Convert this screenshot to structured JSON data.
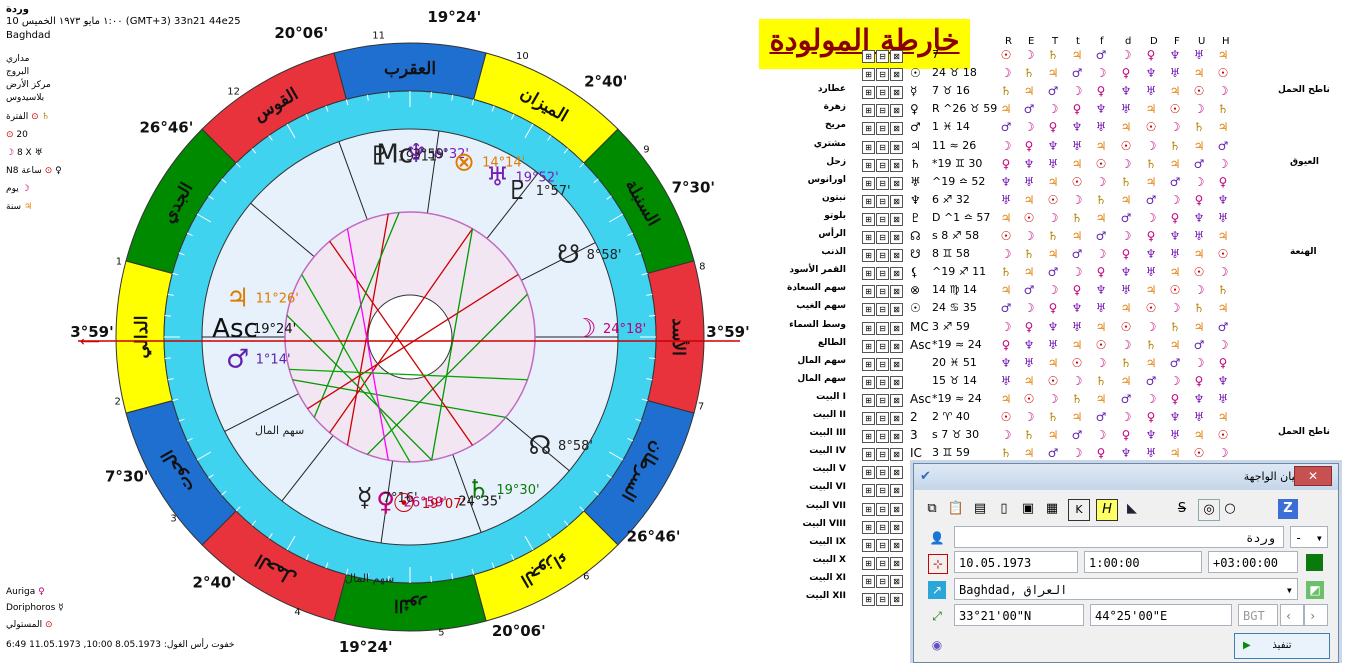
{
  "header": {
    "name": "وردة",
    "date_line": "10 ١:٠٠ مايو ١٩٧٣ الخميس (GMT+3) 33n21 44e25",
    "city": "Baghdad",
    "lines": [
      "مداري",
      "البروج",
      "مركز الأرض",
      "بلاسيدوس"
    ],
    "period_label": "الفترة",
    "period_value": "20",
    "lunar_line": "8 X",
    "hour_line": "N8 ساعة",
    "day_label": "يوم",
    "year_label": "سنة"
  },
  "title": "خارطة المولودة",
  "wheel": {
    "center_labels": [
      "سهم المال",
      "سهم المال"
    ],
    "zodiac_names": [
      "العقرب",
      "الميزان",
      "السنبلة",
      "الأسد",
      "السرطان",
      "الجوزاء",
      "الثور",
      "الحمل",
      "الحوت",
      "الدالي",
      "الجدي",
      "القوس"
    ],
    "outer_degrees": [
      "3°59'",
      "7°30'",
      "2°40'",
      "19°24'",
      "20°06'",
      "26°46'",
      "3°59'",
      "7°30'",
      "2°40'",
      "19°24'",
      "20°06'",
      "26°46'"
    ],
    "house_numbers": [
      "1",
      "2",
      "3",
      "4",
      "5",
      "6",
      "7",
      "8",
      "9",
      "10",
      "11",
      "12"
    ],
    "planet_positions": [
      {
        "glyph": "♀",
        "deg": "26°59'"
      },
      {
        "glyph": "☿",
        "deg": "7°16'"
      },
      {
        "glyph": "☉",
        "deg": "19°07'"
      },
      {
        "glyph": "♄",
        "deg": "19°30'"
      },
      {
        "glyph": "☊",
        "deg": "8°58'"
      },
      {
        "glyph": "☽",
        "deg": "24°18'"
      },
      {
        "glyph": "♃",
        "deg": "11°26'"
      },
      {
        "glyph": "♂",
        "deg": "1°14'"
      },
      {
        "glyph": "☋",
        "deg": "8°58'"
      },
      {
        "glyph": "♇",
        "deg": "19°11'"
      },
      {
        "glyph": "♆",
        "deg": "6°32'"
      },
      {
        "glyph": "♅",
        "deg": "19°52'"
      },
      {
        "glyph": "♇",
        "deg": "1°57'"
      },
      {
        "glyph": "⊗",
        "deg": "14°14'"
      },
      {
        "glyph": "Mc",
        "deg": "3°59'"
      },
      {
        "glyph": "Asc",
        "deg": "19°24'"
      },
      {
        "glyph": "",
        "deg": "24°35'"
      }
    ],
    "axis_labels": [
      "Mc",
      "Asc",
      "IC",
      "MC"
    ]
  },
  "bottom_left": {
    "star1": "Auriga",
    "star2": "Doriphoros",
    "ruler": "المستولي",
    "footer": "خفوت رأس الغول: 8.05.1973 10:00,   11.05.1973  6:49"
  },
  "table": {
    "columns": [
      "R",
      "E",
      "T",
      "t",
      "f",
      "d",
      "D",
      "F",
      "U",
      "H"
    ],
    "rows": [
      {
        "label": "",
        "planet": "",
        "pos": "7"
      },
      {
        "label": "",
        "planet": "☉",
        "pos": "24 ♉ 18"
      },
      {
        "label": "عطارد",
        "planet": "☿",
        "pos": "7 ♉ 16"
      },
      {
        "label": "زهرة",
        "planet": "♀",
        "pos": "R ^26 ♉ 59"
      },
      {
        "label": "مريخ",
        "planet": "♂",
        "pos": "1 ♓ 14"
      },
      {
        "label": "مشتري",
        "planet": "♃",
        "pos": "11 ≈ 26"
      },
      {
        "label": "زحل",
        "planet": "♄",
        "pos": "*19 ♊ 30"
      },
      {
        "label": "اورانوس",
        "planet": "♅",
        "pos": "^19 ≏ 52"
      },
      {
        "label": "نبتون",
        "planet": "♆",
        "pos": "6 ♐ 32"
      },
      {
        "label": "بلوتو",
        "planet": "♇",
        "pos": "D ^1 ≏ 57"
      },
      {
        "label": "الرأس",
        "planet": "☊",
        "pos": "s 8 ♐ 58"
      },
      {
        "label": "الذنب",
        "planet": "☋",
        "pos": "8 ♊ 58"
      },
      {
        "label": "القمر الأسود",
        "planet": "⚸",
        "pos": "^19 ♐ 11"
      },
      {
        "label": "سهم السعادة",
        "planet": "⊗",
        "pos": "14 ♍ 14"
      },
      {
        "label": "سهم الغيب",
        "planet": "☉",
        "pos": "24 ♋ 35"
      },
      {
        "label": "وسط السماء",
        "planet": "MC",
        "pos": "3 ♐ 59"
      },
      {
        "label": "الطالع",
        "planet": "Asc",
        "pos": "*19 ≈ 24"
      },
      {
        "label": "سهم المال",
        "planet": "",
        "pos": "20 ♓ 51"
      },
      {
        "label": "سهم المال",
        "planet": "",
        "pos": "15 ♉ 14"
      },
      {
        "label": "البيت I",
        "planet": "Asc",
        "pos": "*19 ≈ 24"
      },
      {
        "label": "البيت II",
        "planet": "2",
        "pos": "2 ♈ 40"
      },
      {
        "label": "البيت III",
        "planet": "3",
        "pos": "s 7 ♉ 30"
      },
      {
        "label": "البيت IV",
        "planet": "IC",
        "pos": "3 ♊ 59"
      },
      {
        "label": "البيت V",
        "planet": "",
        "pos": ""
      },
      {
        "label": "البيت VI",
        "planet": "",
        "pos": ""
      },
      {
        "label": "البيت VII",
        "planet": "",
        "pos": ""
      },
      {
        "label": "البيت VIII",
        "planet": "",
        "pos": ""
      },
      {
        "label": "البيت IX",
        "planet": "",
        "pos": ""
      },
      {
        "label": "البيت X",
        "planet": "",
        "pos": ""
      },
      {
        "label": "البيت XI",
        "planet": "",
        "pos": ""
      },
      {
        "label": "البيت XII",
        "planet": "",
        "pos": ""
      }
    ],
    "right_labels": [
      "ناطح الحمل",
      "العيوق",
      "الهنعة",
      "ناطح الحمل"
    ]
  },
  "dialog": {
    "title": "بيان الواجهة",
    "close": "✕",
    "name_value": "وردة",
    "name_dropdown": "-",
    "date_value": "10.05.1973",
    "time_value": "1:00:00",
    "tz_value": "+03:00:00",
    "place_value": "Baghdad, العراق",
    "lat_value": "33°21'00\"N",
    "lon_value": "44°25'00\"E",
    "tz_code": "BGT",
    "execute_label": "تنفيذ"
  },
  "colors": {
    "zodiac_fire": "#e8333c",
    "zodiac_earth": "#008a00",
    "zodiac_air": "#ffff00",
    "zodiac_water": "#1f6fd0",
    "inner_ring": "#3fd3f0",
    "title_bg": "#ffff00",
    "title_fg": "#8b0000"
  }
}
